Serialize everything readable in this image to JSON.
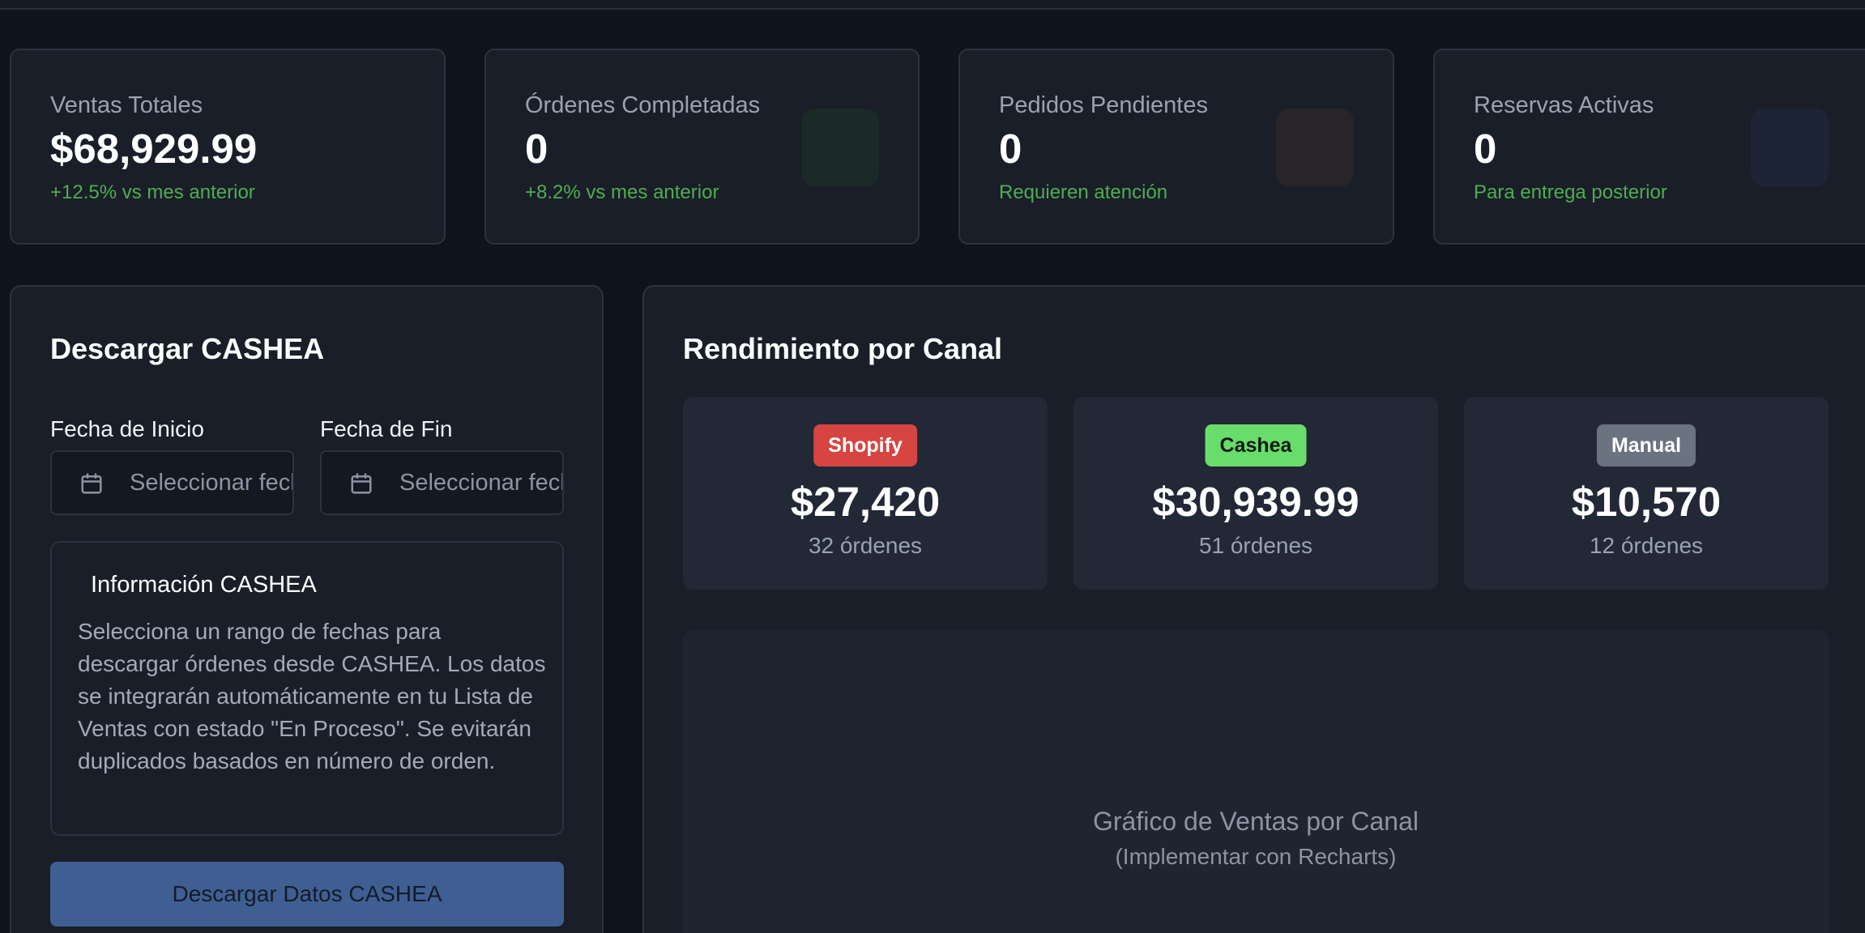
{
  "stats": [
    {
      "title": "Ventas Totales",
      "value": "$68,929.99",
      "sub": "+12.5% vs mes anterior",
      "sub_color": "#4caf50",
      "icon_color": ""
    },
    {
      "title": "Órdenes Completadas",
      "value": "0",
      "sub": "+8.2% vs mes anterior",
      "sub_color": "#4caf50",
      "icon_color": "#1b2a26"
    },
    {
      "title": "Pedidos Pendientes",
      "value": "0",
      "sub": "Requieren atención",
      "sub_color": "#4caf50",
      "icon_color": "#272528"
    },
    {
      "title": "Reservas Activas",
      "value": "0",
      "sub": "Para entrega posterior",
      "sub_color": "#4caf50",
      "icon_color": "#1c2436"
    }
  ],
  "cashea_panel": {
    "title": "Descargar CASHEA",
    "start_label": "Fecha de Inicio",
    "end_label": "Fecha de Fin",
    "start_placeholder": "Seleccionar fecha",
    "end_placeholder": "Seleccionar fecha",
    "icon": "calendar-icon",
    "info_title": "Información CASHEA",
    "info_text": "Selecciona un rango de fechas para descargar órdenes desde CASHEA. Los datos se integrarán automáticamente en tu Lista de Ventas con estado \"En Proceso\". Se evitarán duplicados basados en número de orden.",
    "button_label": "Descargar Datos CASHEA"
  },
  "channel_panel": {
    "title": "Rendimiento por Canal",
    "channels": [
      {
        "badge": "Shopify",
        "badge_bg": "#d64541",
        "badge_fg": "#ffffff",
        "amount": "$27,420",
        "orders": "32 órdenes"
      },
      {
        "badge": "Cashea",
        "badge_bg": "#69dd6b",
        "badge_fg": "#0f1a10",
        "amount": "$30,939.99",
        "orders": "51 órdenes"
      },
      {
        "badge": "Manual",
        "badge_bg": "#6b7280",
        "badge_fg": "#ffffff",
        "amount": "$10,570",
        "orders": "12 órdenes"
      }
    ],
    "chart_title": "Gráfico de Ventas por Canal",
    "chart_subtitle": "(Implementar con Recharts)"
  }
}
